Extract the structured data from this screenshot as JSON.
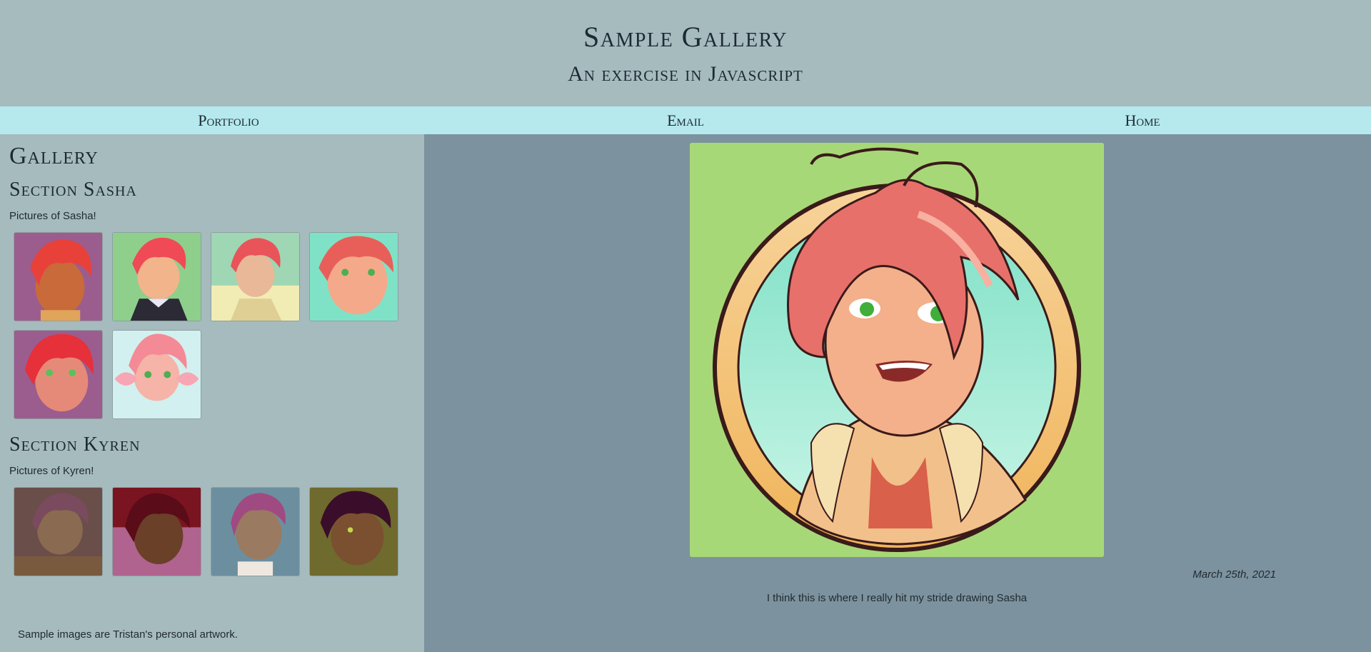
{
  "header": {
    "title": "Sample Gallery",
    "subtitle": "An exercise in Javascript"
  },
  "nav": {
    "items": [
      {
        "label": "Portfolio"
      },
      {
        "label": "Email"
      },
      {
        "label": "Home"
      }
    ]
  },
  "sidebar": {
    "heading": "Gallery",
    "sections": [
      {
        "title": "Section Sasha",
        "description": "Pictures of Sasha!",
        "thumb_backgrounds": [
          "#9b5d8e",
          "#8fcf8c",
          "#9fd6b3",
          "#7fe2c6",
          "#9b5d8e",
          "#d2f0ef"
        ]
      },
      {
        "title": "Section Kyren",
        "description": "Pictures of Kyren!",
        "thumb_backgrounds": [
          "#6a4e4a",
          "#b0638f",
          "#6c8fa0",
          "#6f6a2d"
        ]
      }
    ],
    "footnote": "Sample images are Tristan's personal artwork."
  },
  "featured": {
    "date": "March 25th, 2021",
    "caption": "I think this is where I really hit my stride drawing Sasha",
    "background": "#a7d877"
  },
  "colors": {
    "header_bg": "#a6bbbe",
    "nav_bg": "#b5e9ed",
    "main_bg": "#7c929e"
  }
}
